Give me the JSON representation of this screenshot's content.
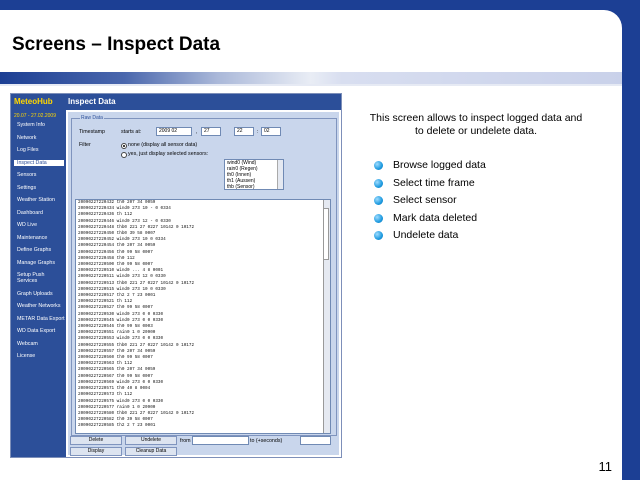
{
  "slide": {
    "title": "Screens – Inspect Data",
    "number": "11",
    "intro": "This screen allows to inspect logged data and to delete or undelete data.",
    "bullets": [
      "Browse logged data",
      "Select time frame",
      "Select sensor",
      "Mark data deleted",
      "Undelete data"
    ]
  },
  "app": {
    "brand": "MeteoHub",
    "title": "Inspect Data",
    "date_range": "20.07 - 27.02.2009",
    "menu": [
      "System Info",
      "Network",
      "Log Files",
      "Inspect Data",
      "Sensors",
      "Settings",
      "Weather Station",
      "Dashboard",
      "WD Live",
      "Maintenance",
      "Define Graphs",
      "Manage Graphs",
      "Setup Push Services",
      "Graph Uploads",
      "Weather Networks",
      "METAR Data Export",
      "WD Data Export",
      "Webcam",
      "License"
    ],
    "active_menu_index": 3,
    "raw_data_label": "Raw Data",
    "timestamp_label": "Timestamp",
    "starts_at_label": "starts at:",
    "year_value": "2009 02",
    "day_value": "27",
    "hour_value": "22",
    "minute_value": "02",
    "filter_label": "Filter",
    "filter_none": "none (display all sensor data)",
    "filter_selected": "yes, just display selected sensors:",
    "sensors": [
      "wind0 (Wind)",
      "rain0 (Regen)",
      "th0 (Innen)",
      "th1 (Aussen)",
      "thb (Sensor)"
    ],
    "data_rows": [
      "20090227220432 th0 207 34 0059",
      "20090227220434 wind0 273 10 - 0 0334",
      "20090227220436 th 112",
      "20090227220446 wind0 273 12 - 0 0330",
      "20090227220448 thb0 221 27 0227 10142 0 10172",
      "20090227220450 thb0 39 58 0007",
      "20090227220452 wind0 273 10 0 0334",
      "20090227220454 th0 207 34 0059",
      "20090227220456 th0 99 58 0007",
      "20090227220458 th0 112",
      "20090227220500 th0 99 58 0007",
      "20090227220510 wind0 ... 4 8 0001",
      "20090227220511 wind0 273 12 0 0330",
      "20090227220513 thb0 221 27 0227 10142 0 10172",
      "20090227220515 wind0 273 10 0 0330",
      "20090227220517 th2 2 7 23 0001",
      "20090227220521 th 112",
      "20090227220527 th0 99 58 0007",
      "20090227220530 wind0 273 0 0 0330",
      "20090227220545 wind0 273 0 0 0330",
      "20090227220546 th0 99 58 0003",
      "20090227220551 rain0 1 0 20900",
      "20090227220553 wind0 273 0 0 0330",
      "20090227220555 thb0 221 27 0227 10142 0 10172",
      "20090227220557 th0 207 34 0059",
      "20090227220560 th0 99 58 0007",
      "20090227220563 th 112",
      "20090227220565 th0 207 34 0059",
      "20090227220567 th0 99 58 0007",
      "20090227220569 wind0 273 0 0 0330",
      "20090227220571 th0 40 8 0004",
      "20090227220573 th 112",
      "20090227220575 wind0 273 0 0 0330",
      "20090227220577 rain0 1 0 20900",
      "20090227220580 thb0 221 27 0227 10142 0 10172",
      "20090227220582 th0 39 58 0007",
      "20090227220585 th2 2 7 23 0001"
    ],
    "delete_label": "Delete",
    "undelete_label": "Undelete",
    "from_label": "from",
    "to_label": "to (+seconds)",
    "display_label": "Display",
    "cleanup_label": "Cleanup Data"
  }
}
